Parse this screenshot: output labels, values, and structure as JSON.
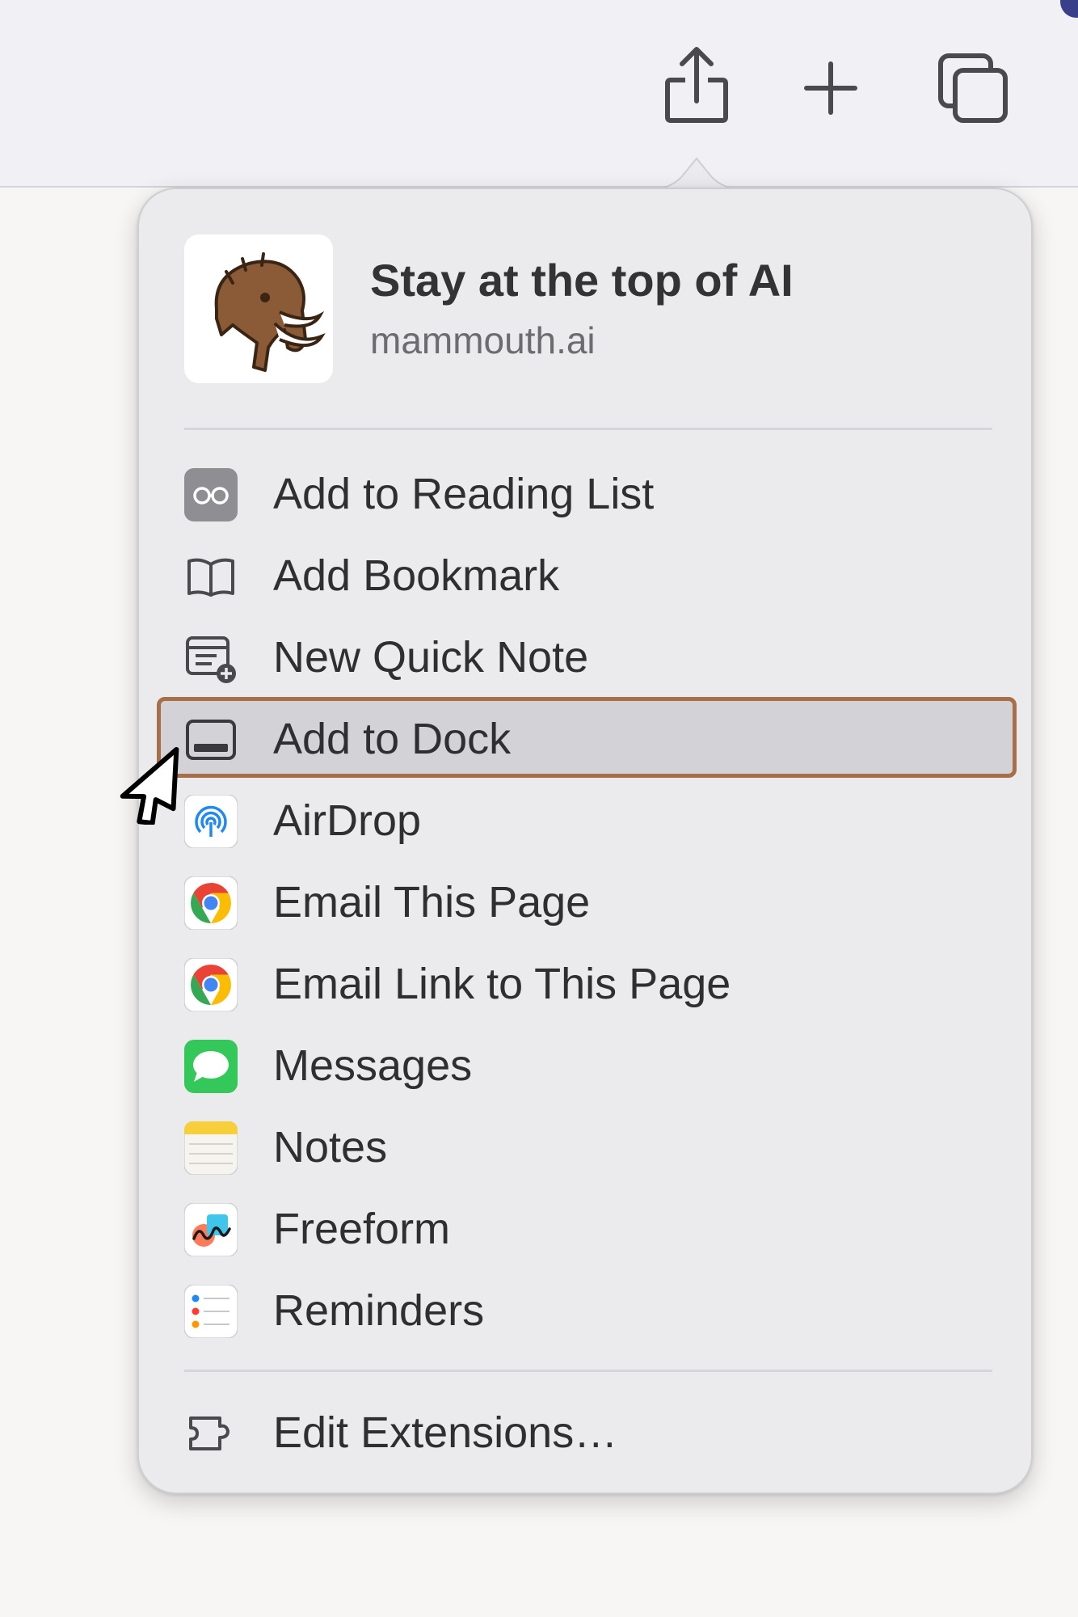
{
  "toolbar": {
    "buttons": [
      {
        "name": "share",
        "icon": "share-icon"
      },
      {
        "name": "new-tab",
        "icon": "plus-icon"
      },
      {
        "name": "tab-overview",
        "icon": "tabs-icon"
      }
    ],
    "accent_color": "#3a3f8a"
  },
  "popover": {
    "header": {
      "title": "Stay at the top of AI",
      "subtitle": "mammouth.ai",
      "thumbnail_icon": "mammoth-logo"
    },
    "items": [
      {
        "label": "Add to Reading List",
        "icon": "reading-glasses-icon"
      },
      {
        "label": "Add Bookmark",
        "icon": "book-icon"
      },
      {
        "label": "New Quick Note",
        "icon": "quick-note-icon"
      },
      {
        "label": "Add to Dock",
        "icon": "dock-icon",
        "highlighted": true
      },
      {
        "label": "AirDrop",
        "icon": "airdrop-icon"
      },
      {
        "label": "Email This Page",
        "icon": "chrome-icon"
      },
      {
        "label": "Email Link to This Page",
        "icon": "chrome-icon"
      },
      {
        "label": "Messages",
        "icon": "messages-icon"
      },
      {
        "label": "Notes",
        "icon": "notes-icon"
      },
      {
        "label": "Freeform",
        "icon": "freeform-icon"
      },
      {
        "label": "Reminders",
        "icon": "reminders-icon"
      }
    ],
    "footer": {
      "label": "Edit Extensions…",
      "icon": "extensions-icon"
    },
    "highlight_color": "#a86e48"
  }
}
